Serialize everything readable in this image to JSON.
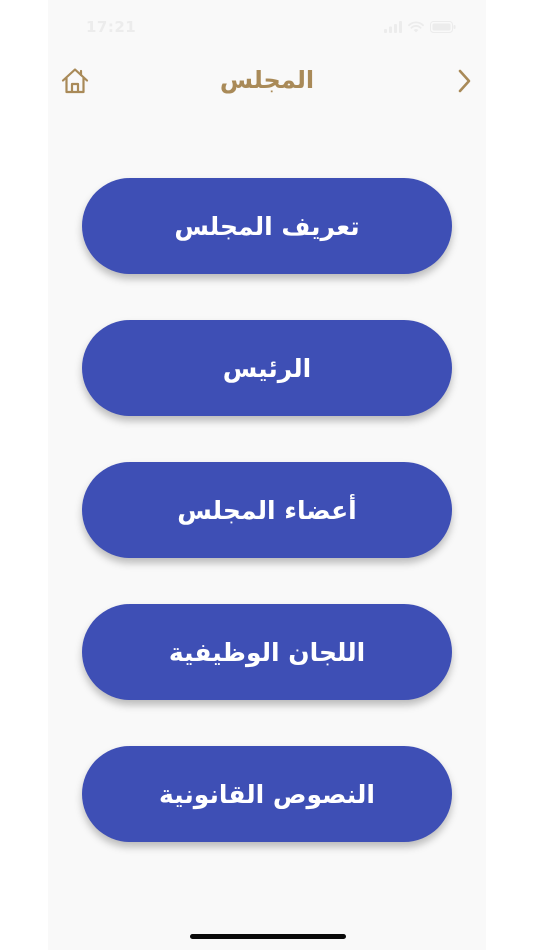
{
  "status_bar": {
    "time": "17:21"
  },
  "nav": {
    "title": "المجلس",
    "home_icon": "home-icon",
    "back_icon": "chevron-right-icon"
  },
  "menu": {
    "items": [
      {
        "label": "تعريف المجلس"
      },
      {
        "label": "الرئيس"
      },
      {
        "label": "أعضاء المجلس"
      },
      {
        "label": "اللجان الوظيفية"
      },
      {
        "label": "النصوص القانونية"
      }
    ]
  },
  "colors": {
    "accent_gold": "#a98a58",
    "button_blue": "#3e4fb5",
    "background": "#f9f9f9"
  }
}
